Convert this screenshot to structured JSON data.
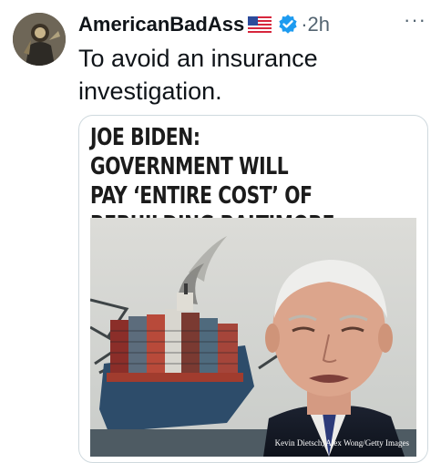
{
  "tweet": {
    "author_name": "AmericanBadAss",
    "time": "2h",
    "separator": "·",
    "more_label": "···",
    "text": "To avoid an insurance\ninvestigation."
  },
  "media": {
    "headline": "JOE BIDEN: GOVERNMENT WILL\nPAY ‘ENTIRE COST’ OF\nREBUILDING BALTIMORE BRIDGE",
    "photo_credit": "Kevin Dietsch, Alex Wong/Getty Images"
  },
  "icons": {
    "flag": "us-flag-icon",
    "verified": "verified-badge-icon",
    "more": "more-options-icon"
  },
  "colors": {
    "verified_blue": "#1d9bf0",
    "secondary_text": "#536471",
    "primary_text": "#0f1419",
    "border": "#cfd9de"
  }
}
